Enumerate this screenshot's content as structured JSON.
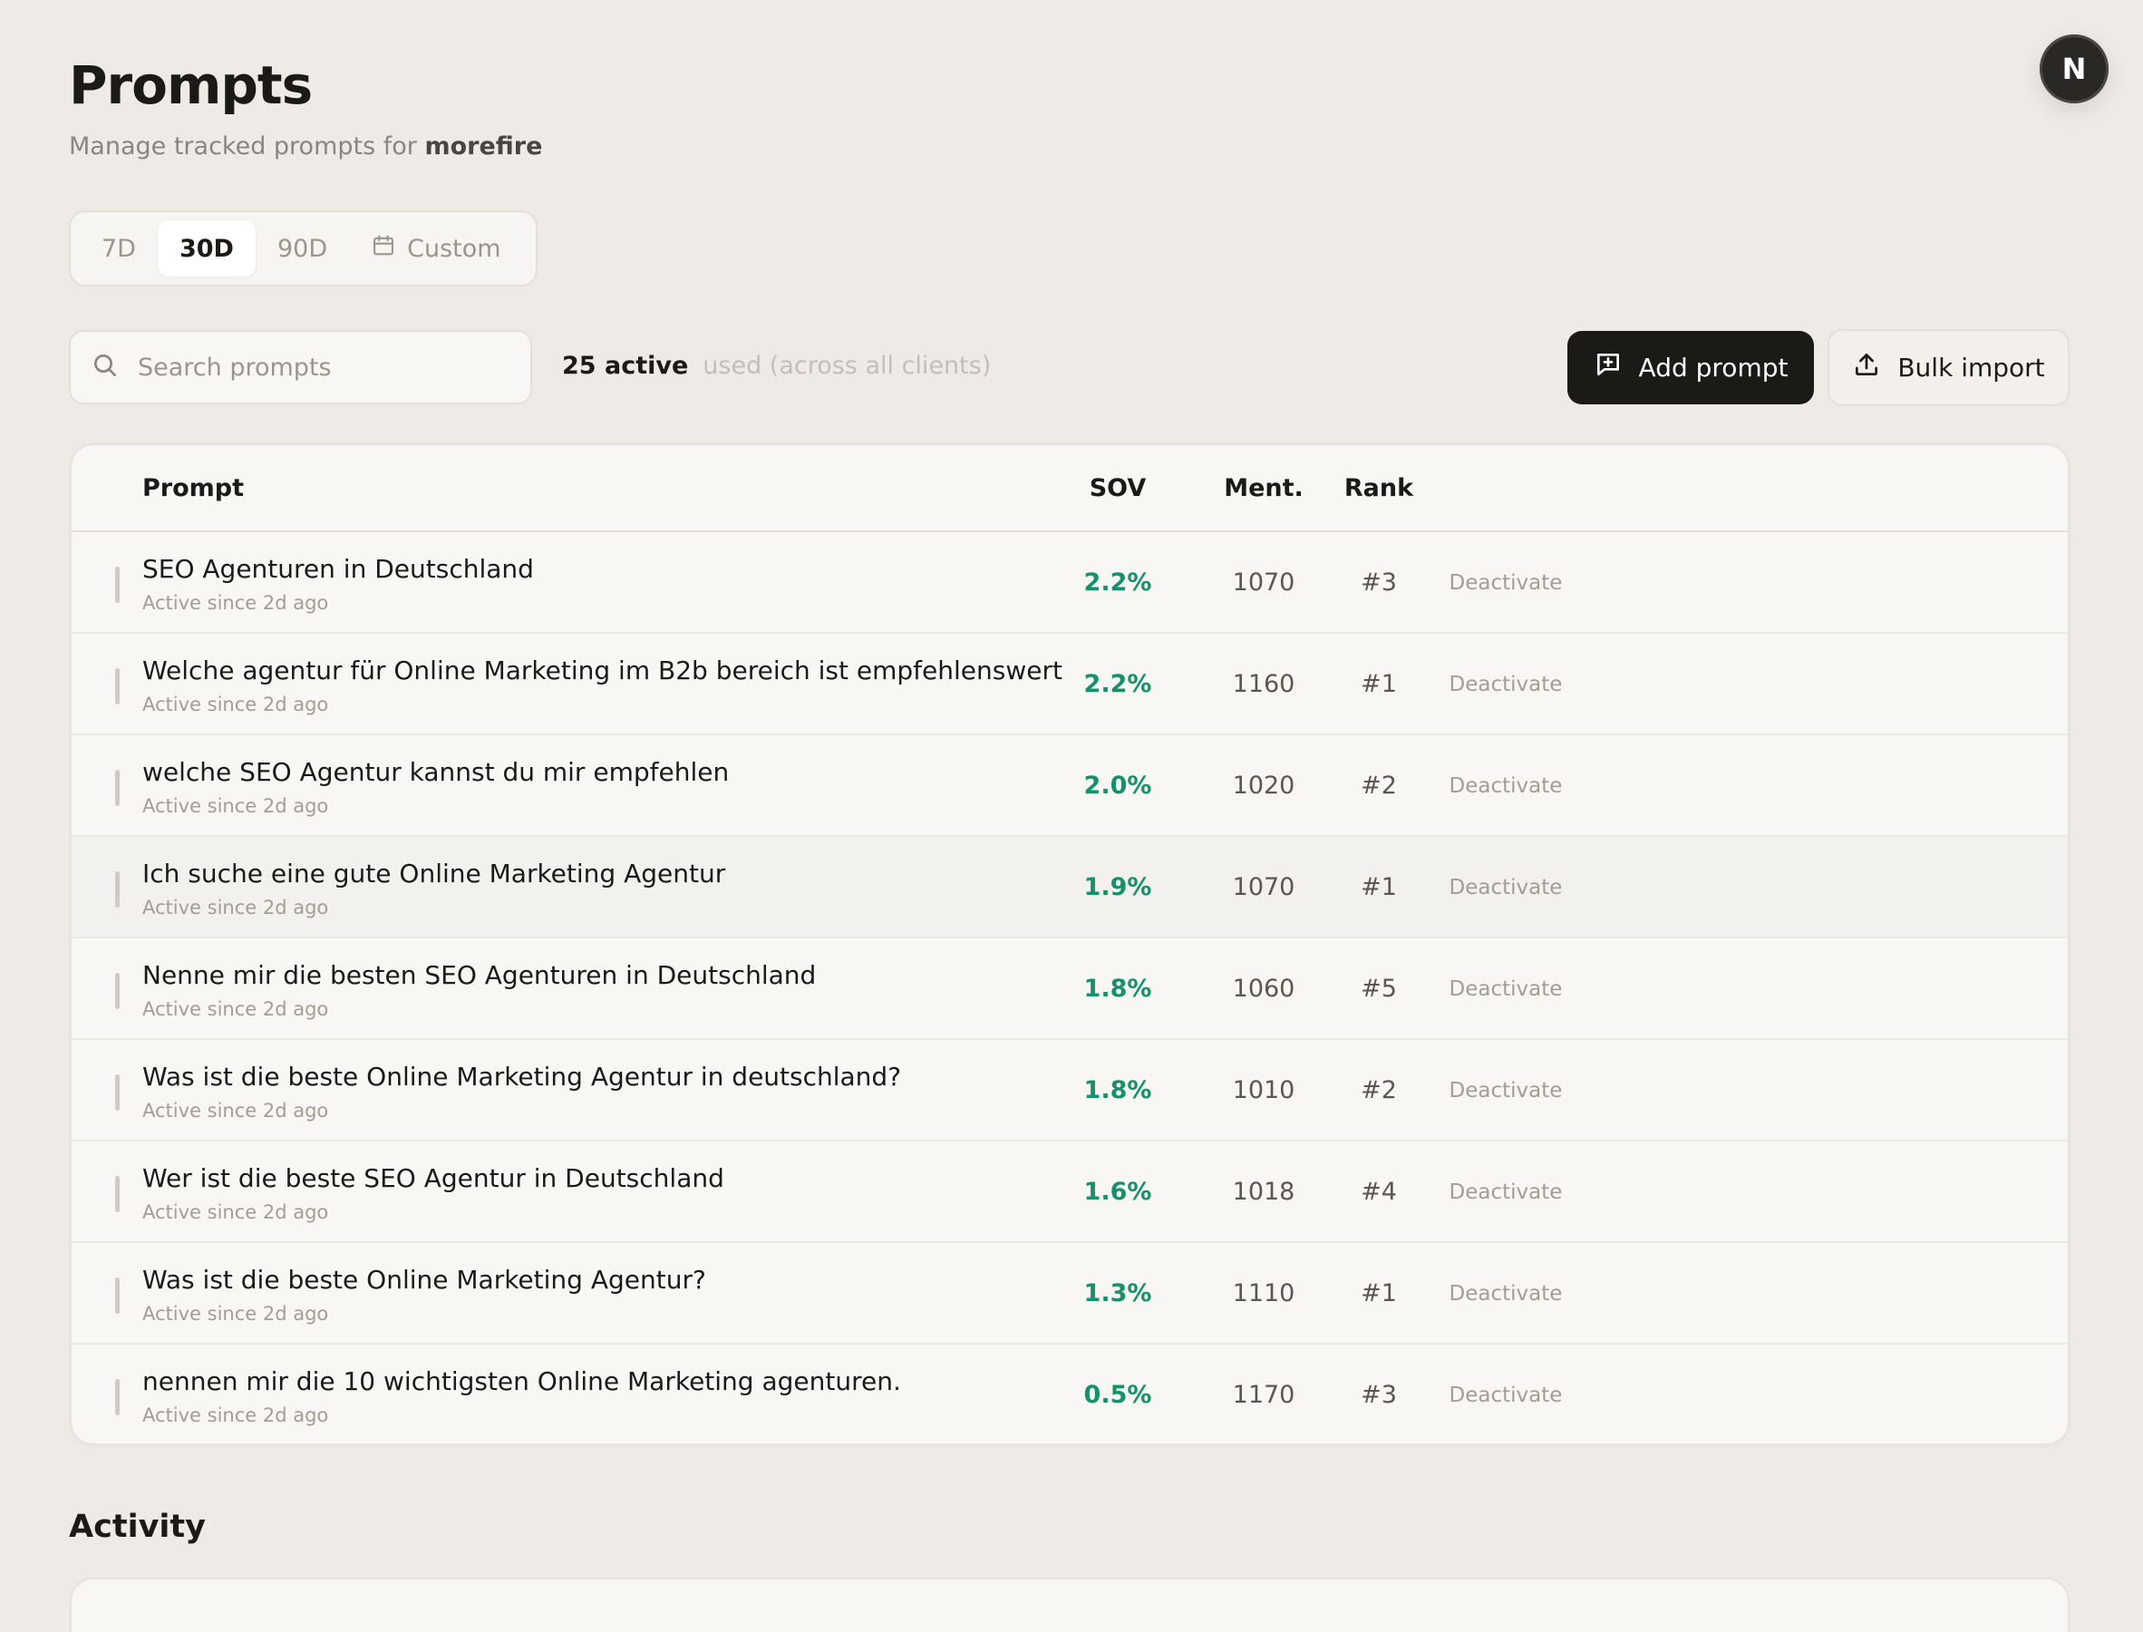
{
  "header": {
    "title": "Prompts",
    "subtitle_prefix": "Manage tracked prompts for",
    "client_name": "morefire"
  },
  "avatar": {
    "initial": "N"
  },
  "range": {
    "options": [
      {
        "label": "7D",
        "active": false
      },
      {
        "label": "30D",
        "active": true
      },
      {
        "label": "90D",
        "active": false
      },
      {
        "label": "Custom",
        "active": false,
        "icon": "calendar-icon"
      }
    ]
  },
  "search": {
    "placeholder": "Search prompts",
    "value": ""
  },
  "summary": {
    "active_label": "25 active",
    "note": "used (across all clients)"
  },
  "actions": {
    "add_label": "Add prompt",
    "bulk_label": "Bulk import"
  },
  "table": {
    "columns": {
      "prompt": "Prompt",
      "sov": "SOV",
      "ment": "Ment.",
      "rank": "Rank"
    },
    "rows": [
      {
        "prompt": "SEO Agenturen in Deutschland",
        "since": "Active since 2d ago",
        "sov": "2.2%",
        "ment": "1070",
        "rank": "#3",
        "action": "Deactivate"
      },
      {
        "prompt": "Welche agentur für Online Marketing im B2b bereich ist empfehlenswert",
        "since": "Active since 2d ago",
        "sov": "2.2%",
        "ment": "1160",
        "rank": "#1",
        "action": "Deactivate"
      },
      {
        "prompt": "welche SEO Agentur kannst du mir empfehlen",
        "since": "Active since 2d ago",
        "sov": "2.0%",
        "ment": "1020",
        "rank": "#2",
        "action": "Deactivate"
      },
      {
        "prompt": "Ich suche eine gute Online Marketing Agentur",
        "since": "Active since 2d ago",
        "sov": "1.9%",
        "ment": "1070",
        "rank": "#1",
        "action": "Deactivate"
      },
      {
        "prompt": "Nenne mir die besten SEO Agenturen in Deutschland",
        "since": "Active since 2d ago",
        "sov": "1.8%",
        "ment": "1060",
        "rank": "#5",
        "action": "Deactivate"
      },
      {
        "prompt": "Was ist die beste Online Marketing Agentur in deutschland?",
        "since": "Active since 2d ago",
        "sov": "1.8%",
        "ment": "1010",
        "rank": "#2",
        "action": "Deactivate"
      },
      {
        "prompt": "Wer ist die beste SEO Agentur in Deutschland",
        "since": "Active since 2d ago",
        "sov": "1.6%",
        "ment": "1018",
        "rank": "#4",
        "action": "Deactivate"
      },
      {
        "prompt": "Was ist die beste Online Marketing Agentur?",
        "since": "Active since 2d ago",
        "sov": "1.3%",
        "ment": "1110",
        "rank": "#1",
        "action": "Deactivate"
      },
      {
        "prompt": "nennen mir die 10 wichtigsten Online Marketing agenturen.",
        "since": "Active since 2d ago",
        "sov": "0.5%",
        "ment": "1170",
        "rank": "#3",
        "action": "Deactivate"
      }
    ]
  },
  "activity": {
    "title": "Activity"
  },
  "colors": {
    "accent_green": "#17906b",
    "primary_dark": "#1c1a17",
    "background": "#eeebe6"
  }
}
